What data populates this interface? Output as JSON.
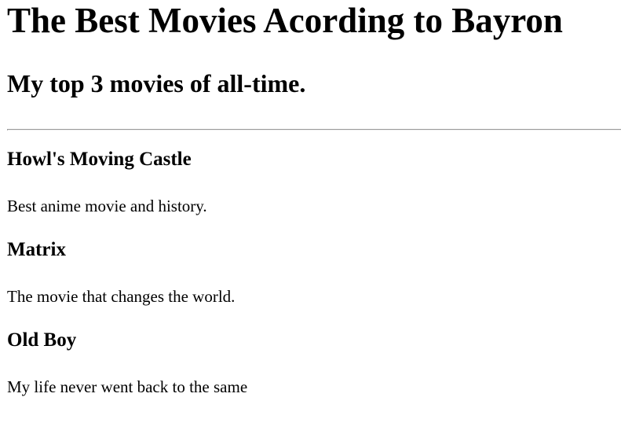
{
  "page": {
    "title": "The Best Movies Acording to Bayron",
    "subtitle": "My top 3 movies of all-time."
  },
  "movies": [
    {
      "title": "Howl's Moving Castle",
      "description": "Best anime movie and history."
    },
    {
      "title": "Matrix",
      "description": "The movie that changes the world."
    },
    {
      "title": "Old Boy",
      "description": "My life never went back to the same"
    }
  ]
}
